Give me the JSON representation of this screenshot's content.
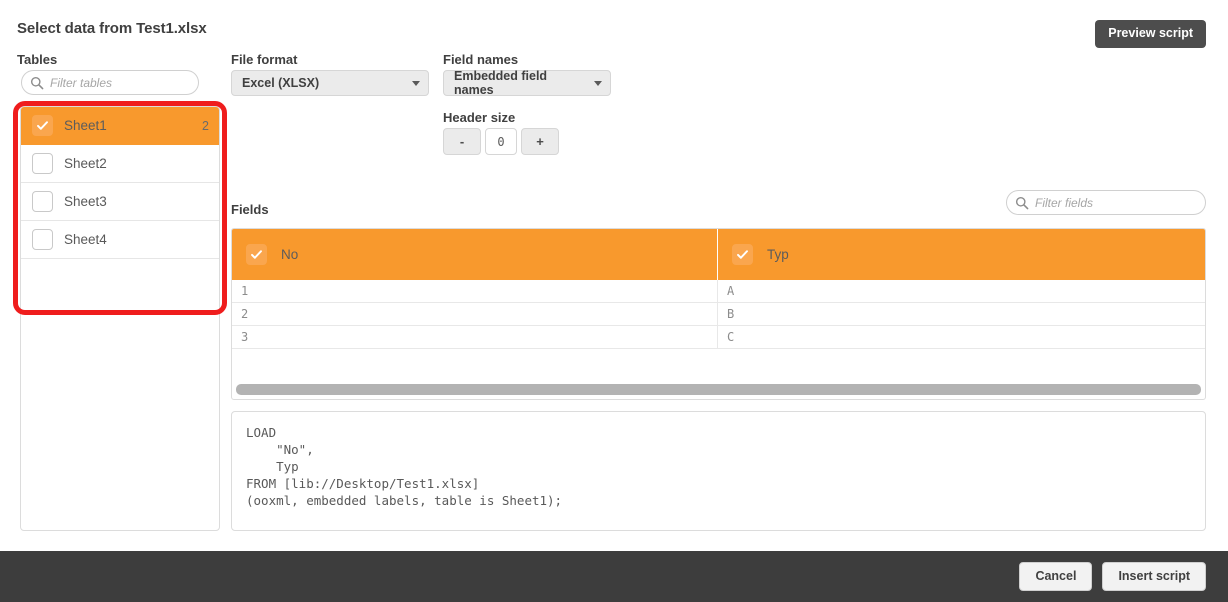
{
  "dialog": {
    "title": "Select data from Test1.xlsx",
    "preview_script_label": "Preview script"
  },
  "tables_panel": {
    "label": "Tables",
    "filter_placeholder": "Filter tables",
    "items": [
      {
        "name": "Sheet1",
        "count": "2",
        "selected": true
      },
      {
        "name": "Sheet2",
        "count": "",
        "selected": false
      },
      {
        "name": "Sheet3",
        "count": "",
        "selected": false
      },
      {
        "name": "Sheet4",
        "count": "",
        "selected": false
      }
    ]
  },
  "file_format": {
    "label": "File format",
    "value": "Excel (XLSX)"
  },
  "field_names": {
    "label": "Field names",
    "value": "Embedded field names"
  },
  "header_size": {
    "label": "Header size",
    "decrement_label": "-",
    "value": "0",
    "increment_label": "+"
  },
  "fields": {
    "label": "Fields",
    "filter_placeholder": "Filter fields",
    "columns": [
      {
        "name": "No",
        "selected": true
      },
      {
        "name": "Typ",
        "selected": true
      }
    ],
    "rows": [
      {
        "no": "1",
        "typ": "A"
      },
      {
        "no": "2",
        "typ": "B"
      },
      {
        "no": "3",
        "typ": "C"
      }
    ]
  },
  "script": {
    "text": "LOAD\n    \"No\",\n    Typ\nFROM [lib://Desktop/Test1.xlsx]\n(ooxml, embedded labels, table is Sheet1);"
  },
  "footer": {
    "cancel_label": "Cancel",
    "insert_script_label": "Insert script"
  },
  "colors": {
    "accent_orange": "#f8992d",
    "checkbox_orange": "#faa64e",
    "annotation_red": "#ef1d1d",
    "footer_dark": "#3d3d3d",
    "button_dark": "#4d4d4d"
  }
}
